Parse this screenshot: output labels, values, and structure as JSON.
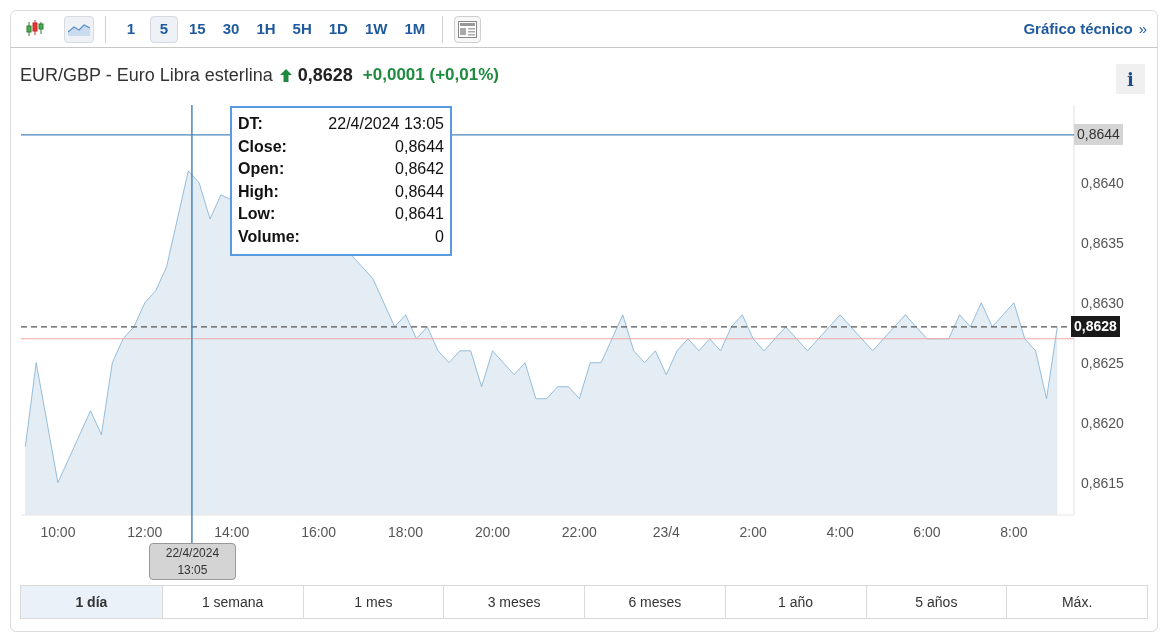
{
  "toolbar": {
    "chart_types": [
      {
        "kind": "candlestick",
        "selected": false
      },
      {
        "kind": "area",
        "selected": true
      }
    ],
    "intervals": [
      {
        "label": "1",
        "selected": false
      },
      {
        "label": "5",
        "selected": true
      },
      {
        "label": "15",
        "selected": false
      },
      {
        "label": "30",
        "selected": false
      },
      {
        "label": "1H",
        "selected": false
      },
      {
        "label": "5H",
        "selected": false
      },
      {
        "label": "1D",
        "selected": false
      },
      {
        "label": "1W",
        "selected": false
      },
      {
        "label": "1M",
        "selected": false
      }
    ],
    "link": {
      "label": "Gráfico técnico",
      "arrow": "»"
    }
  },
  "header": {
    "title": "EUR/GBP - Euro Libra esterlina",
    "price": "0,8628",
    "change": "+0,0001 (+0,01%)",
    "info": "i"
  },
  "chart": {
    "tooltip": [
      {
        "label": "DT:",
        "value": "22/4/2024 13:05"
      },
      {
        "label": "Close:",
        "value": "0,8644"
      },
      {
        "label": "Open:",
        "value": "0,8642"
      },
      {
        "label": "High:",
        "value": "0,8644"
      },
      {
        "label": "Low:",
        "value": "0,8641"
      },
      {
        "label": "Volume:",
        "value": "0"
      }
    ],
    "chart_data": {
      "type": "area",
      "x": [
        "2024-04-22T09:15",
        "2024-04-22T09:30",
        "2024-04-22T09:45",
        "2024-04-22T10:00",
        "2024-04-22T10:15",
        "2024-04-22T10:30",
        "2024-04-22T10:45",
        "2024-04-22T11:00",
        "2024-04-22T11:15",
        "2024-04-22T11:30",
        "2024-04-22T11:45",
        "2024-04-22T12:00",
        "2024-04-22T12:15",
        "2024-04-22T12:30",
        "2024-04-22T12:45",
        "2024-04-22T13:00",
        "2024-04-22T13:15",
        "2024-04-22T13:30",
        "2024-04-22T13:45",
        "2024-04-22T16:45",
        "2024-04-22T17:00",
        "2024-04-22T17:15",
        "2024-04-22T17:30",
        "2024-04-22T17:45",
        "2024-04-22T18:00",
        "2024-04-22T18:15",
        "2024-04-22T18:30",
        "2024-04-22T18:45",
        "2024-04-22T19:00",
        "2024-04-22T19:15",
        "2024-04-22T19:30",
        "2024-04-22T19:45",
        "2024-04-22T20:00",
        "2024-04-22T20:15",
        "2024-04-22T20:30",
        "2024-04-22T20:45",
        "2024-04-22T21:00",
        "2024-04-22T21:15",
        "2024-04-22T21:30",
        "2024-04-22T21:45",
        "2024-04-22T22:00",
        "2024-04-22T22:15",
        "2024-04-22T22:30",
        "2024-04-22T22:45",
        "2024-04-22T23:00",
        "2024-04-22T23:15",
        "2024-04-22T23:30",
        "2024-04-22T23:45",
        "2024-04-23T00:00",
        "2024-04-23T00:15",
        "2024-04-23T00:30",
        "2024-04-23T00:45",
        "2024-04-23T01:00",
        "2024-04-23T01:15",
        "2024-04-23T01:30",
        "2024-04-23T01:45",
        "2024-04-23T02:00",
        "2024-04-23T02:15",
        "2024-04-23T02:30",
        "2024-04-23T02:45",
        "2024-04-23T03:00",
        "2024-04-23T03:15",
        "2024-04-23T03:30",
        "2024-04-23T03:45",
        "2024-04-23T04:00",
        "2024-04-23T04:15",
        "2024-04-23T04:30",
        "2024-04-23T04:45",
        "2024-04-23T05:00",
        "2024-04-23T05:15",
        "2024-04-23T05:30",
        "2024-04-23T05:45",
        "2024-04-23T06:00",
        "2024-04-23T06:15",
        "2024-04-23T06:30",
        "2024-04-23T06:45",
        "2024-04-23T07:00",
        "2024-04-23T07:15",
        "2024-04-23T07:30",
        "2024-04-23T07:45",
        "2024-04-23T08:00",
        "2024-04-23T08:15",
        "2024-04-23T08:30",
        "2024-04-23T08:45",
        "2024-04-23T09:00"
      ],
      "series": [
        {
          "color": "#7eaed3",
          "values": [
            0.8618,
            0.8625,
            0.862,
            0.8615,
            0.8617,
            0.8619,
            0.8621,
            0.8619,
            0.8625,
            0.8627,
            0.8628,
            0.863,
            0.8631,
            0.8633,
            0.8637,
            0.8641,
            0.864,
            0.8637,
            0.8639,
            0.8634,
            0.8633,
            0.8632,
            0.863,
            0.8628,
            0.8629,
            0.8627,
            0.8628,
            0.8626,
            0.8625,
            0.8626,
            0.8626,
            0.8623,
            0.8626,
            0.8625,
            0.8624,
            0.8625,
            0.8622,
            0.8622,
            0.8623,
            0.8623,
            0.8622,
            0.8625,
            0.8625,
            0.8627,
            0.8629,
            0.8626,
            0.8625,
            0.8626,
            0.8624,
            0.8626,
            0.8627,
            0.8626,
            0.8627,
            0.8626,
            0.8628,
            0.8629,
            0.8627,
            0.8626,
            0.8627,
            0.8628,
            0.8627,
            0.8626,
            0.8627,
            0.8628,
            0.8629,
            0.8628,
            0.8627,
            0.8626,
            0.8627,
            0.8628,
            0.8629,
            0.8628,
            0.8627,
            0.8627,
            0.8627,
            0.8629,
            0.8628,
            0.863,
            0.8628,
            0.8629,
            0.863,
            0.8627,
            0.8626,
            0.8622,
            0.8628
          ]
        }
      ],
      "xlim": [
        "2024-04-22T09:09",
        "2024-04-23T09:23"
      ],
      "ylim": [
        0.86123,
        0.86465
      ],
      "xticks": [
        {
          "value": "2024-04-22T10:00",
          "label": "10:00"
        },
        {
          "value": "2024-04-22T12:00",
          "label": "12:00"
        },
        {
          "value": "2024-04-22T14:00",
          "label": "14:00"
        },
        {
          "value": "2024-04-22T16:00",
          "label": "16:00"
        },
        {
          "value": "2024-04-22T18:00",
          "label": "18:00"
        },
        {
          "value": "2024-04-22T20:00",
          "label": "20:00"
        },
        {
          "value": "2024-04-22T22:00",
          "label": "22:00"
        },
        {
          "value": "2024-04-23T00:00",
          "label": "23/4"
        },
        {
          "value": "2024-04-23T02:00",
          "label": "2:00"
        },
        {
          "value": "2024-04-23T04:00",
          "label": "4:00"
        },
        {
          "value": "2024-04-23T06:00",
          "label": "6:00"
        },
        {
          "value": "2024-04-23T08:00",
          "label": "8:00"
        }
      ],
      "yticks": [
        {
          "value": 0.8615,
          "label": "0,8615"
        },
        {
          "value": 0.862,
          "label": "0,8620"
        },
        {
          "value": 0.8625,
          "label": "0,8625"
        },
        {
          "value": 0.863,
          "label": "0,8630"
        },
        {
          "value": 0.8635,
          "label": "0,8635"
        },
        {
          "value": 0.864,
          "label": "0,8640"
        }
      ],
      "ref_lines": [
        {
          "axis": "y",
          "value": 0.8627,
          "color": "#f2a9a9"
        },
        {
          "axis": "y",
          "value": 0.8644,
          "color": "#4d86bd",
          "label": "0,8644"
        },
        {
          "axis": "y",
          "value": 0.8628,
          "color": "#555555",
          "label": "0,8628"
        },
        {
          "axis": "x",
          "value": "2024-04-22T13:05",
          "color": "#4d86bd",
          "label": "22/4/2024 13:05"
        }
      ]
    }
  },
  "ranges": [
    {
      "label": "1 día",
      "selected": true
    },
    {
      "label": "1 semana",
      "selected": false
    },
    {
      "label": "1 mes",
      "selected": false
    },
    {
      "label": "3 meses",
      "selected": false
    },
    {
      "label": "6 meses",
      "selected": false
    },
    {
      "label": "1 año",
      "selected": false
    },
    {
      "label": "5 años",
      "selected": false
    },
    {
      "label": "Máx.",
      "selected": false
    }
  ]
}
